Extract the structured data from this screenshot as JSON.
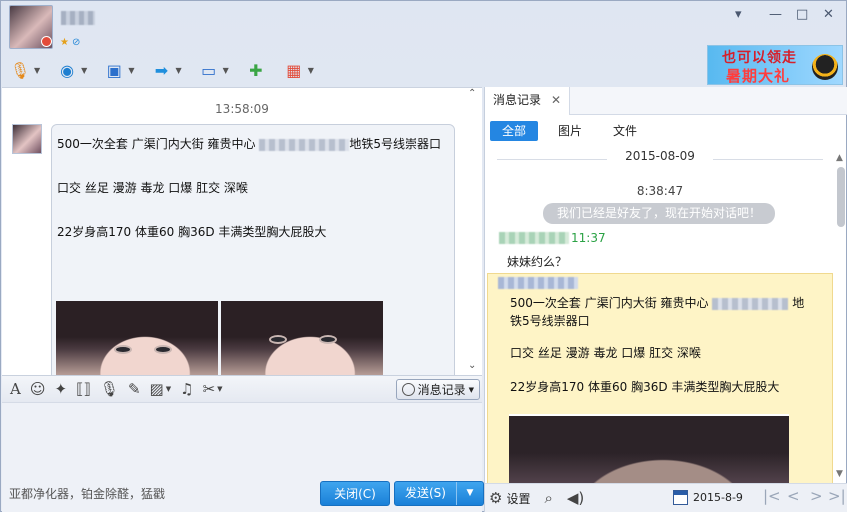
{
  "contact": {
    "nickname_blurred": true
  },
  "toolbar": {
    "items": [
      "microphone-icon",
      "camera-icon",
      "screen-share-icon",
      "file-transfer-icon",
      "remote-desktop-icon",
      "message-plus-icon",
      "apps-icon"
    ]
  },
  "banner": {
    "line1": "也可以领走",
    "line2": "暑期大礼"
  },
  "chat": {
    "time": "13:58:09",
    "msg_lines": [
      "500一次全套 广渠门内大街 雍贵中心",
      "地铁5号线崇器口",
      "口交 丝足  漫游 毒龙 口爆 肛交  深喉",
      "22岁身高170 体重60 胸36D 丰满类型胸大屁股大"
    ]
  },
  "input": {
    "history_label": "消息记录",
    "signature": "亚都净化器，铂金除醛，猛戳",
    "close_label": "关闭(C)",
    "send_label": "发送(S)"
  },
  "history": {
    "tab_label": "消息记录",
    "filters": [
      "全部",
      "图片",
      "文件"
    ],
    "date": "2015-08-09",
    "time": "8:38:47",
    "system_msg": "我们已经是好友了，现在开始对话吧！",
    "sender_time": "11:37",
    "msg": "妹妹约么？",
    "hl_lines": [
      "500一次全套 广渠门内大街 雍贵中心",
      "地",
      "铁5号线崇器口",
      "口交 丝足  漫游 毒龙 口爆 肛交  深喉",
      "22岁身高170 体重60 胸36D 丰满类型胸大屁股大"
    ],
    "settings_label": "设置",
    "footer_date": "2015-8-9"
  },
  "colors": {
    "accent": "#2486e2",
    "highlight_bg": "#fef4c6",
    "sender_green": "#2ba245"
  }
}
